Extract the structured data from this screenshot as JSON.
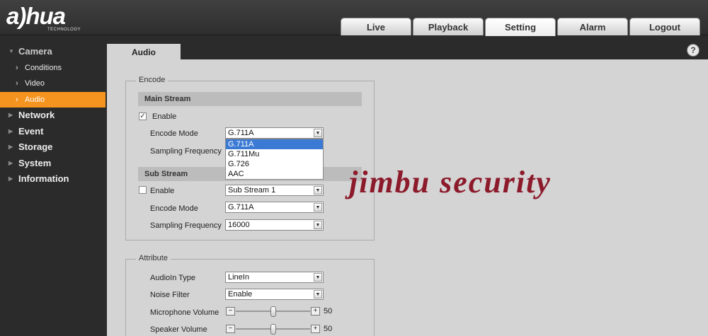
{
  "brand": {
    "logo": "a)hua",
    "logo_sub": "TECHNOLOGY"
  },
  "nav": {
    "tabs": [
      {
        "label": "Live"
      },
      {
        "label": "Playback"
      },
      {
        "label": "Setting"
      },
      {
        "label": "Alarm"
      },
      {
        "label": "Logout"
      }
    ],
    "active_tab": "Setting"
  },
  "sidebar": {
    "camera": {
      "label": "Camera",
      "items": [
        {
          "label": "Conditions"
        },
        {
          "label": "Video"
        },
        {
          "label": "Audio"
        }
      ]
    },
    "others": [
      {
        "label": "Network"
      },
      {
        "label": "Event"
      },
      {
        "label": "Storage"
      },
      {
        "label": "System"
      },
      {
        "label": "Information"
      }
    ]
  },
  "page": {
    "tab_label": "Audio",
    "help_label": "?"
  },
  "encode": {
    "legend": "Encode",
    "main_stream": {
      "title": "Main Stream",
      "enable_label": "Enable",
      "enable_checked": "✓",
      "encode_mode_label": "Encode Mode",
      "encode_mode_value": "G.711A",
      "sampling_label": "Sampling Frequency",
      "dropdown_options": [
        "G.711A",
        "G.711Mu",
        "G.726",
        "AAC"
      ]
    },
    "sub_stream": {
      "title": "Sub Stream",
      "enable_label": "Enable",
      "stream_value": "Sub Stream 1",
      "encode_mode_label": "Encode Mode",
      "encode_mode_value": "G.711A",
      "sampling_label": "Sampling Frequency",
      "sampling_value": "16000"
    }
  },
  "attribute": {
    "legend": "Attribute",
    "audioin_label": "AudioIn Type",
    "audioin_value": "LineIn",
    "noise_label": "Noise Filter",
    "noise_value": "Enable",
    "mic_label": "Microphone Volume",
    "mic_value": "50",
    "speaker_label": "Speaker Volume",
    "speaker_value": "50"
  },
  "watermark": "jimbu security",
  "glyphs": {
    "dd": "▼",
    "minus": "−",
    "plus": "+",
    "chev": "›",
    "tri_down": "▼",
    "tri_right": "▶"
  }
}
